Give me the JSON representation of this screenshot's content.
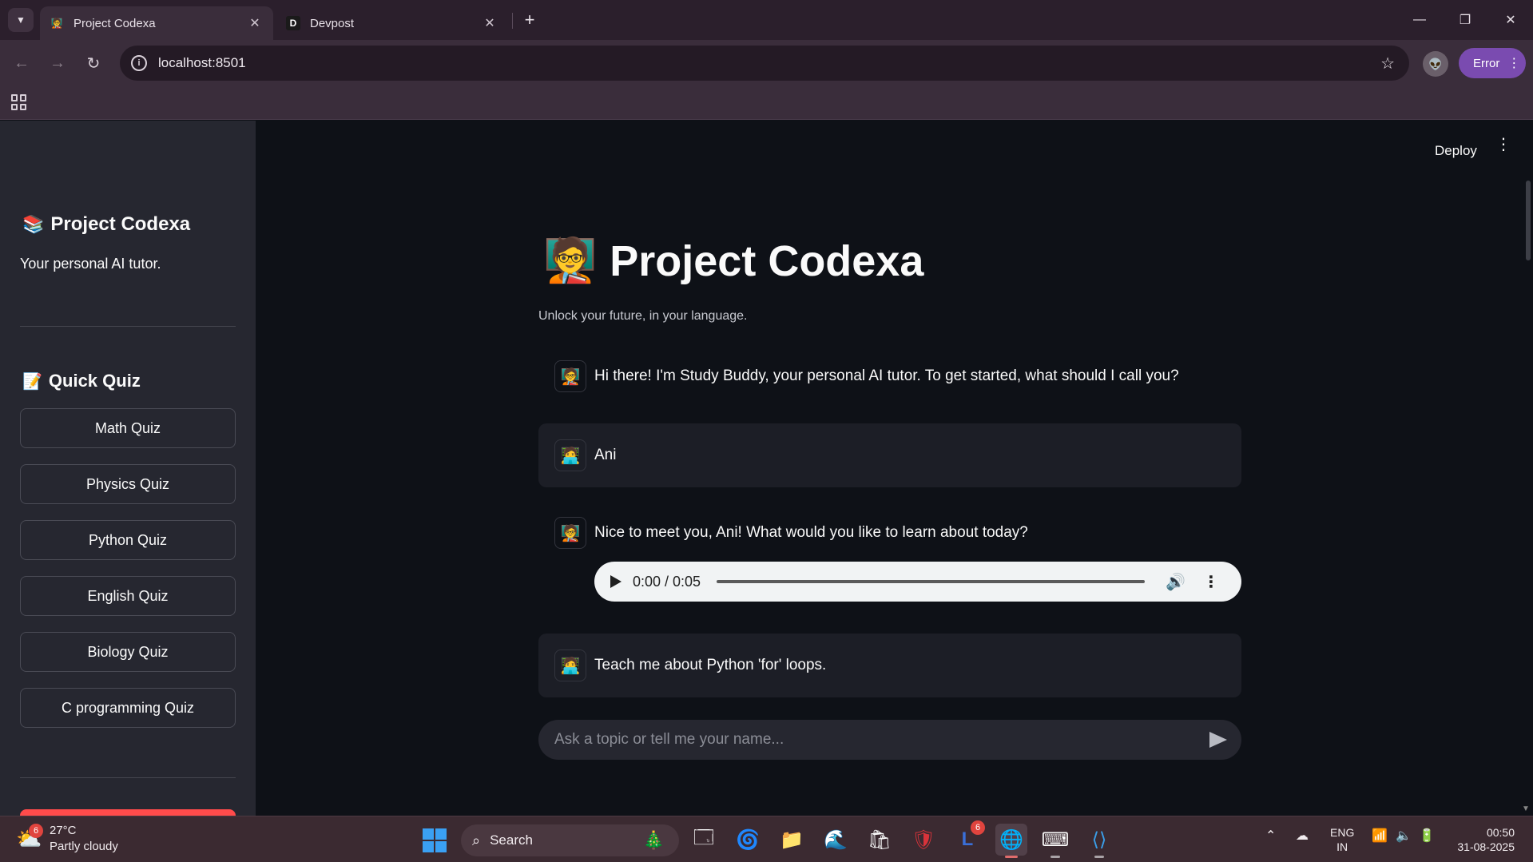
{
  "browser": {
    "tabs": [
      {
        "title": "Project Codexa",
        "favicon": "🧑‍🏫",
        "active": true
      },
      {
        "title": "Devpost",
        "favicon": "D",
        "active": false
      }
    ],
    "url": "localhost:8501",
    "error_label": "Error"
  },
  "sidebar": {
    "title": "Project Codexa",
    "title_emoji": "📚",
    "subtitle": "Your personal AI tutor.",
    "quiz_heading": "Quick Quiz",
    "quiz_emoji": "📝",
    "quiz_buttons": [
      "Math Quiz",
      "Physics Quiz",
      "Python Quiz",
      "English Quiz",
      "Biology Quiz",
      "C programming Quiz"
    ]
  },
  "main": {
    "deploy_label": "Deploy",
    "hero_emoji": "🧑‍🏫",
    "title": "Project Codexa",
    "subtitle": "Unlock your future, in your language.",
    "messages": [
      {
        "role": "assistant",
        "avatar": "🧑‍🏫",
        "text": "Hi there! I'm Study Buddy, your personal AI tutor. To get started, what should I call you?"
      },
      {
        "role": "user",
        "avatar": "🧑‍💻",
        "text": "Ani"
      },
      {
        "role": "assistant",
        "avatar": "🧑‍🏫",
        "text": "Nice to meet you, Ani! What would you like to learn about today?"
      },
      {
        "role": "user",
        "avatar": "🧑‍💻",
        "text": "Teach me about Python 'for' loops."
      }
    ],
    "audio": {
      "time": "0:00 / 0:05",
      "progress": 0
    },
    "chat_placeholder": "Ask a topic or tell me your name..."
  },
  "taskbar": {
    "weather_temp": "27°C",
    "weather_desc": "Partly cloudy",
    "weather_badge": "6",
    "search_label": "Search",
    "mail_badge": "6",
    "lang_top": "ENG",
    "lang_bottom": "IN",
    "time": "00:50",
    "date": "31-08-2025"
  }
}
